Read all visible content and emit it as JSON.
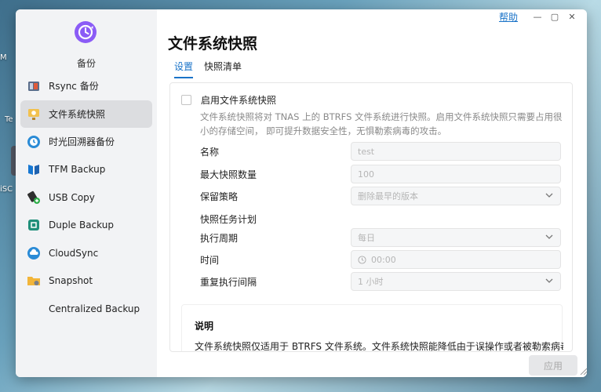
{
  "desktop": {
    "fragments": [
      "M",
      "Te",
      "iSC"
    ]
  },
  "sidebar": {
    "app_name": "备份",
    "items": [
      {
        "label": "Rsync 备份",
        "icon": "rsync-icon"
      },
      {
        "label": "文件系统快照",
        "icon": "snapshot-camera-icon",
        "active": true
      },
      {
        "label": "时光回溯器备份",
        "icon": "time-machine-icon"
      },
      {
        "label": "TFM Backup",
        "icon": "tfm-icon"
      },
      {
        "label": "USB Copy",
        "icon": "usb-copy-icon"
      },
      {
        "label": "Duple Backup",
        "icon": "duple-icon"
      },
      {
        "label": "CloudSync",
        "icon": "cloud-icon"
      },
      {
        "label": "Snapshot",
        "icon": "folder-snapshot-icon"
      },
      {
        "label": "Centralized Backup",
        "icon": ""
      }
    ]
  },
  "titlebar": {
    "help": "帮助",
    "minimize": "—",
    "maximize": "▢",
    "close": "✕"
  },
  "main": {
    "title": "文件系统快照",
    "tabs": [
      {
        "label": "设置",
        "active": true
      },
      {
        "label": "快照清单"
      }
    ]
  },
  "form": {
    "enable_label": "启用文件系统快照",
    "enabled": false,
    "description": "文件系统快照将对 TNAS 上的 BTRFS 文件系统进行快照。启用文件系统快照只需要占用很小的存储空间， 即可提升数据安全性，无惧勒索病毒的攻击。",
    "name": {
      "label": "名称",
      "value": "test"
    },
    "max_count": {
      "label": "最大快照数量",
      "value": "100"
    },
    "retention": {
      "label": "保留策略",
      "value": "删除最早的版本"
    },
    "schedule_heading": "快照任务计划",
    "period": {
      "label": "执行周期",
      "value": "每日"
    },
    "time": {
      "label": "时间",
      "value": "00:00"
    },
    "repeat": {
      "label": "重复执行间隔",
      "value": "1 小时"
    }
  },
  "note": {
    "title": "说明",
    "text": "文件系统快照仅适用于 BTRFS 文件系统。文件系统快照能降低由于误操作或者被勒索病毒"
  },
  "apply_label": "应用",
  "colors": {
    "accent": "#1a73c8",
    "sidebar_bg": "#f2f3f5",
    "active_item": "#dcdde0"
  }
}
